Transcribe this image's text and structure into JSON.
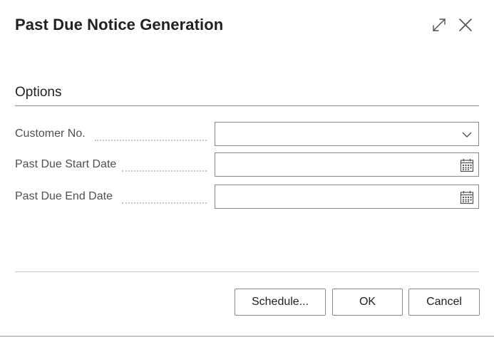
{
  "dialog": {
    "title": "Past Due Notice Generation",
    "expand_icon": "expand-diagonal-arrows",
    "close_icon": "close-x"
  },
  "options": {
    "section_title": "Options",
    "fields": [
      {
        "label": "Customer No.",
        "value": "",
        "control": "dropdown",
        "icon": "chevron-down"
      },
      {
        "label": "Past Due Start Date",
        "value": "",
        "control": "date",
        "icon": "calendar"
      },
      {
        "label": "Past Due End Date",
        "value": "",
        "control": "date",
        "icon": "calendar"
      }
    ]
  },
  "actions": {
    "schedule_label": "Schedule...",
    "ok_label": "OK",
    "cancel_label": "Cancel"
  },
  "colors": {
    "text": "#212121",
    "label": "#505050",
    "border": "#8a8a8a",
    "rule": "#c8c8c8"
  }
}
